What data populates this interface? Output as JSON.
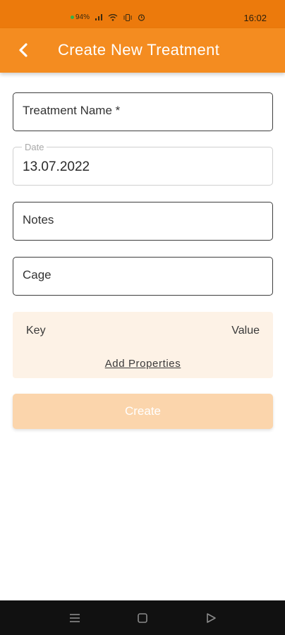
{
  "status_bar": {
    "battery": "94%",
    "time": "16:02"
  },
  "app_bar": {
    "title": "Create New Treatment",
    "back_icon": "chevron-left-icon"
  },
  "form": {
    "treatment_name_placeholder": "Treatment Name *",
    "date_label": "Date",
    "date_value": "13.07.2022",
    "notes_placeholder": "Notes",
    "cage_placeholder": "Cage"
  },
  "properties": {
    "key_header": "Key",
    "value_header": "Value",
    "add_label": "Add Properties"
  },
  "actions": {
    "create_label": "Create"
  },
  "colors": {
    "status_bar": "#ec7a0c",
    "app_bar": "#f48c20",
    "properties_bg": "#fdf2e6",
    "create_button": "#fbd5ac"
  },
  "nav_bar": {
    "icons": [
      "menu-icon",
      "home-square-icon",
      "back-triangle-icon"
    ]
  }
}
